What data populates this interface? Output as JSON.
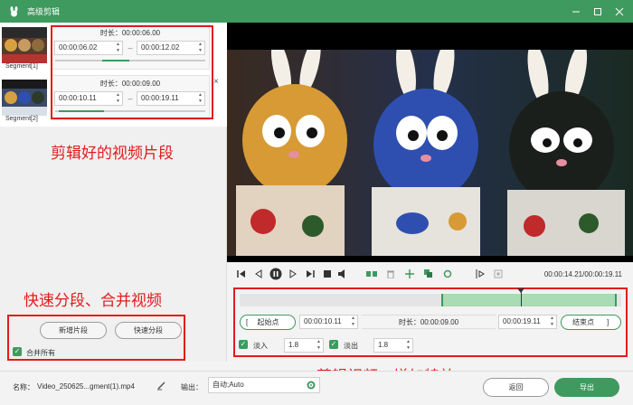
{
  "window": {
    "title": "高级剪辑",
    "icons": [
      "rabbit-logo-icon",
      "minimize-icon",
      "maximize-icon",
      "close-icon"
    ]
  },
  "segments": [
    {
      "label": "Segment[1]",
      "duration": "时长：00:00:06.00",
      "start": "00:00:06.02",
      "end": "00:00:12.02",
      "progress": 0.18
    },
    {
      "label": "Segment[2]",
      "duration": "时长：00:00:09.00",
      "start": "00:00:10.11",
      "end": "00:00:19.11",
      "progress": 0.3
    }
  ],
  "annotations": {
    "segments": "剪辑好的视频片段",
    "split_merge": "快速分段、合并视频",
    "edit_effects": "剪辑视频、增加特效"
  },
  "left_actions": {
    "add_segment": "新增片段",
    "quick_split": "快速分段",
    "merge_all": "合并所有"
  },
  "player": {
    "time_readout": "00:00:14.21/00:00:19.11",
    "icons": [
      "prev-mark-icon",
      "step-back-icon",
      "pause-icon",
      "step-forward-icon",
      "stop-icon",
      "volume-icon",
      "split-icon",
      "trash-icon",
      "add-icon",
      "copy-icon",
      "reset-icon",
      "mark-in-icon",
      "mark-out-icon"
    ],
    "playhead_fraction": 0.75,
    "selection": [
      0.53,
      1.0
    ]
  },
  "trim": {
    "start_label": "起始点",
    "start_value": "00:00:10.11",
    "duration": "时长：00:00:09.00",
    "end_value": "00:00:19.11",
    "end_label": "结束点",
    "fade_in_label": "淡入",
    "fade_in_value": "1.8",
    "fade_out_label": "淡出",
    "fade_out_value": "1.8"
  },
  "footer": {
    "name_label": "名称：",
    "name_value": "Video_250625...gment(1).mp4",
    "output_label": "输出：",
    "output_value": "自动;Auto",
    "back": "返回",
    "export": "导出"
  },
  "colors": {
    "accent": "#3e9a5e",
    "annotation": "#e21c1c"
  }
}
